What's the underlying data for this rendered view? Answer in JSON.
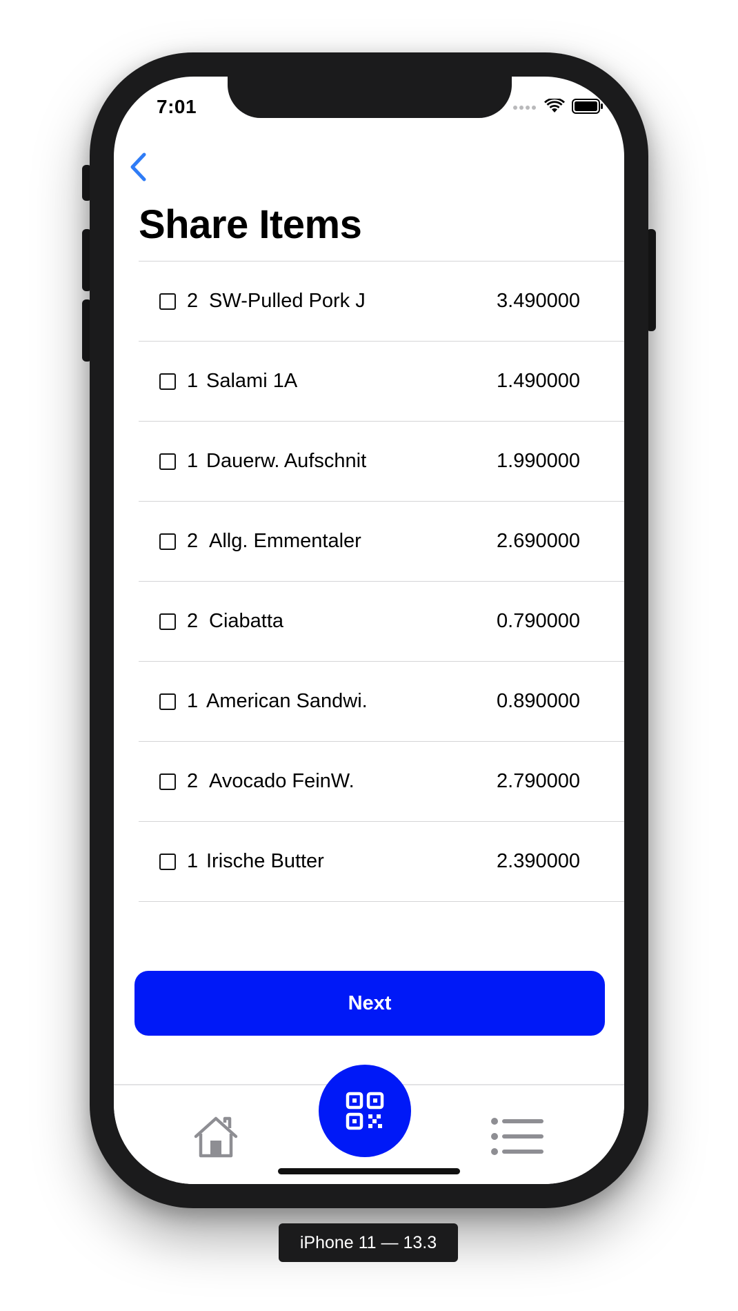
{
  "status_bar": {
    "time": "7:01"
  },
  "nav": {
    "back_icon": "chevron-left-icon",
    "title": "Share Items"
  },
  "items": [
    {
      "qty": "2",
      "name": "SW-Pulled Pork J",
      "price": "3.490000",
      "checked": false
    },
    {
      "qty": "1",
      "name": "Salami 1A",
      "price": "1.490000",
      "checked": false
    },
    {
      "qty": "1",
      "name": "Dauerw. Aufschnit",
      "price": "1.990000",
      "checked": false
    },
    {
      "qty": "2",
      "name": "Allg. Emmentaler",
      "price": "2.690000",
      "checked": false
    },
    {
      "qty": "2",
      "name": "Ciabatta",
      "price": "0.790000",
      "checked": false
    },
    {
      "qty": "1",
      "name": "American Sandwi.",
      "price": "0.890000",
      "checked": false
    },
    {
      "qty": "2",
      "name": "Avocado FeinW.",
      "price": "2.790000",
      "checked": false
    },
    {
      "qty": "1",
      "name": "Irische Butter",
      "price": "2.390000",
      "checked": false
    }
  ],
  "actions": {
    "next_label": "Next"
  },
  "tabbar": {
    "home_icon": "home-icon",
    "scan_icon": "qr-code-icon",
    "list_icon": "list-icon"
  },
  "device": {
    "label": "iPhone 11 — 13.3"
  },
  "colors": {
    "accent": "#0019f7",
    "back_chevron": "#2f7cf6",
    "frame": "#1b1b1c",
    "tab_icon": "#8e8e93"
  }
}
